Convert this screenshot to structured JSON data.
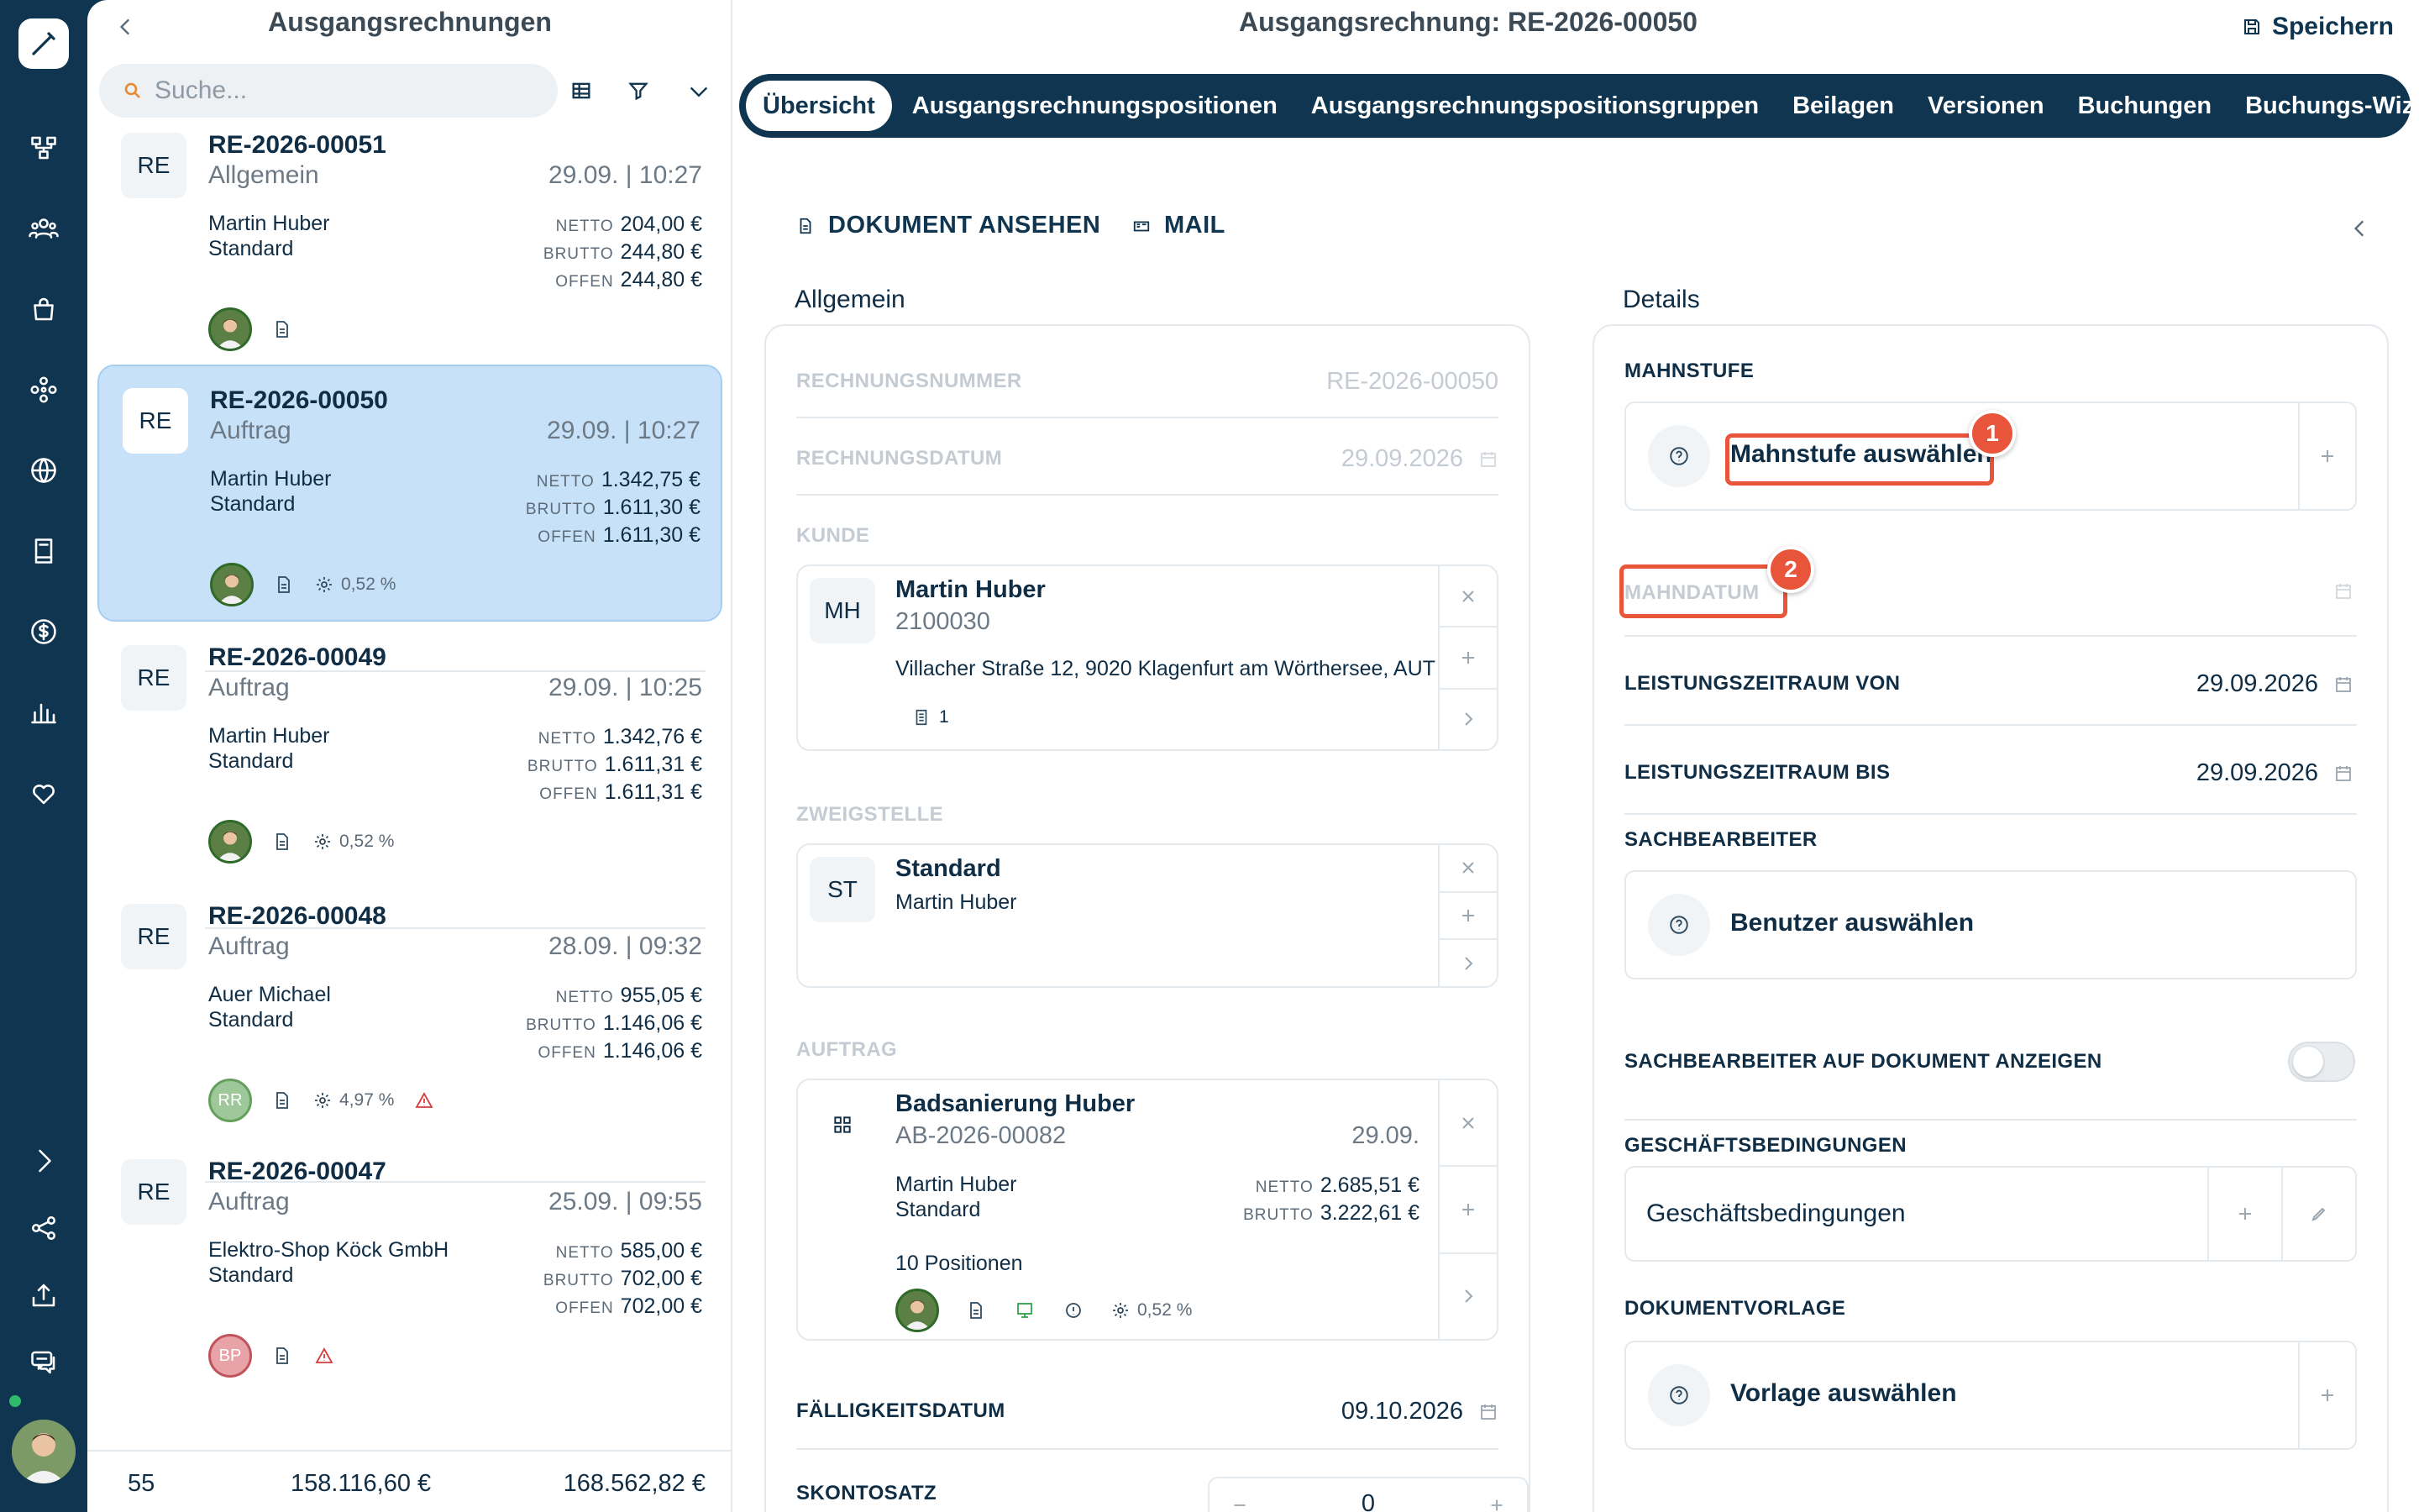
{
  "list": {
    "title": "Ausgangsrechnungen",
    "search_placeholder": "Suche...",
    "net_label": "NETTO",
    "gross_label": "BRUTTO",
    "open_label": "OFFEN",
    "items": [
      {
        "badge": "RE",
        "number": "RE-2026-00051",
        "type": "Allgemein",
        "date": "29.09. | 10:27",
        "customer": "Martin Huber",
        "branch": "Standard",
        "net": "204,00 €",
        "gross": "244,80 €",
        "open": "244,80 €",
        "avatar": "",
        "pct": "",
        "warn": false
      },
      {
        "badge": "RE",
        "number": "RE-2026-00050",
        "type": "Auftrag",
        "date": "29.09. | 10:27",
        "customer": "Martin Huber",
        "branch": "Standard",
        "net": "1.342,75 €",
        "gross": "1.611,30 €",
        "open": "1.611,30 €",
        "avatar": "",
        "pct": "0,52 %",
        "warn": false
      },
      {
        "badge": "RE",
        "number": "RE-2026-00049",
        "type": "Auftrag",
        "date": "29.09. | 10:25",
        "customer": "Martin Huber",
        "branch": "Standard",
        "net": "1.342,76 €",
        "gross": "1.611,31 €",
        "open": "1.611,31 €",
        "avatar": "",
        "pct": "0,52 %",
        "warn": false
      },
      {
        "badge": "RE",
        "number": "RE-2026-00048",
        "type": "Auftrag",
        "date": "28.09. | 09:32",
        "customer": "Auer Michael",
        "branch": "Standard",
        "net": "955,05 €",
        "gross": "1.146,06 €",
        "open": "1.146,06 €",
        "avatar": "RR",
        "pct": "4,97 %",
        "warn": true
      },
      {
        "badge": "RE",
        "number": "RE-2026-00047",
        "type": "Auftrag",
        "date": "25.09. | 09:55",
        "customer": "Elektro-Shop Köck GmbH",
        "branch": "Standard",
        "net": "585,00 €",
        "gross": "702,00 €",
        "open": "702,00 €",
        "avatar": "BP",
        "pct": "",
        "warn": true
      }
    ],
    "footer": {
      "count": "55",
      "net_total": "158.116,60 €",
      "gross_total": "168.562,82 €"
    }
  },
  "detail": {
    "title": "Ausgangsrechnung: RE-2026-00050",
    "save_label": "Speichern",
    "tabs": [
      "Übersicht",
      "Ausgangsrechnungspositionen",
      "Ausgangsrechnungspositionsgruppen",
      "Beilagen",
      "Versionen",
      "Buchungen",
      "Buchungs-Wizard"
    ],
    "actions": {
      "view_document": "DOKUMENT ANSEHEN",
      "mail": "MAIL"
    },
    "general": {
      "heading": "Allgemein",
      "invoice_number_label": "RECHNUNGSNUMMER",
      "invoice_number": "RE-2026-00050",
      "invoice_date_label": "RECHNUNGSDATUM",
      "invoice_date": "29.09.2026",
      "customer_label": "KUNDE",
      "customer": {
        "badge": "MH",
        "name": "Martin Huber",
        "number": "2100030",
        "address": "Villacher Straße 12, 9020 Klagenfurt am Wörthersee, AUT",
        "docs": "1"
      },
      "branch_label": "ZWEIGSTELLE",
      "branch": {
        "badge": "ST",
        "name": "Standard",
        "contact": "Martin Huber"
      },
      "order_label": "AUFTRAG",
      "order": {
        "name": "Badsanierung Huber",
        "number": "AB-2026-00082",
        "date": "29.09.",
        "customer": "Martin Huber",
        "branch": "Standard",
        "net_label": "NETTO",
        "net": "2.685,51 €",
        "gross_label": "BRUTTO",
        "gross": "3.222,61 €",
        "positions": "10 Positionen",
        "pct": "0,52 %"
      },
      "due_date_label": "FÄLLIGKEITSDATUM",
      "due_date": "09.10.2026",
      "discount_label": "SKONTOSATZ",
      "discount_value": "0"
    },
    "details": {
      "heading": "Details",
      "dunning_level_label": "MAHNSTUFE",
      "dunning_level_placeholder": "Mahnstufe auswählen",
      "dunning_date_label": "MAHNDATUM",
      "service_from_label": "LEISTUNGSZEITRAUM VON",
      "service_from": "29.09.2026",
      "service_to_label": "LEISTUNGSZEITRAUM BIS",
      "service_to": "29.09.2026",
      "clerk_label": "SACHBEARBEITER",
      "clerk_placeholder": "Benutzer auswählen",
      "show_clerk_label": "SACHBEARBEITER AUF DOKUMENT ANZEIGEN",
      "terms_label": "GESCHÄFTSBEDINGUNGEN",
      "terms_placeholder": "Geschäftsbedingungen",
      "template_label": "DOKUMENTVORLAGE",
      "template_placeholder": "Vorlage auswählen"
    },
    "annotations": [
      "1",
      "2"
    ]
  },
  "colors": {
    "navy": "#0f3550",
    "selected": "#c7e1f8",
    "highlight": "#e8553a",
    "search_icon": "#e8892f"
  }
}
